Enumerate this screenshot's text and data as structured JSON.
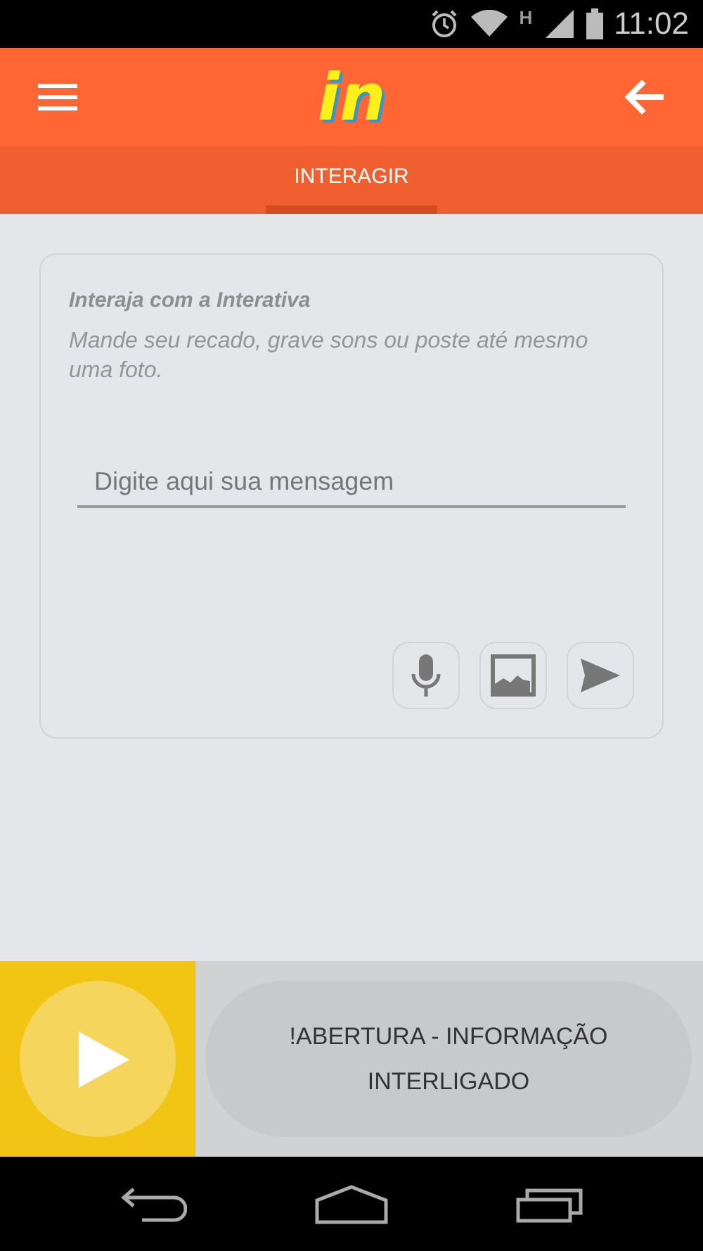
{
  "status_bar": {
    "network": "H",
    "time": "11:02"
  },
  "app_bar": {
    "logo": "in"
  },
  "tabs": [
    {
      "label": "INTERAGIR",
      "selected": true
    }
  ],
  "card": {
    "title": "Interaja com a Interativa",
    "subtitle": "Mande seu recado, grave sons ou poste até mesmo uma foto.",
    "message": {
      "placeholder": "Digite aqui sua mensagem"
    },
    "actions": [
      {
        "kind": "mic"
      },
      {
        "kind": "image"
      },
      {
        "kind": "send"
      }
    ]
  },
  "player": {
    "playing": false,
    "now_playing": "!ABERTURA - INFORMAÇÃO INTERLIGADO"
  }
}
